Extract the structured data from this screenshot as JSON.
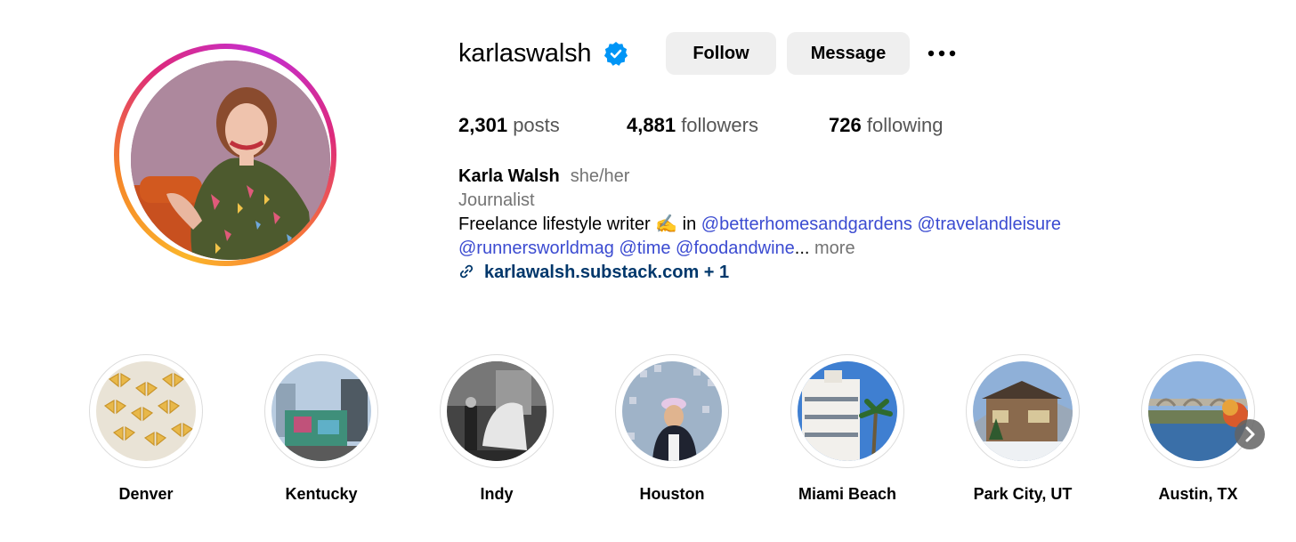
{
  "profile": {
    "username": "karlaswalsh",
    "verified": true,
    "follow_label": "Follow",
    "message_label": "Message",
    "more_icon": "more-horizontal-icon"
  },
  "stats": {
    "posts_count": "2,301",
    "posts_label": "posts",
    "followers_count": "4,881",
    "followers_label": "followers",
    "following_count": "726",
    "following_label": "following"
  },
  "bio": {
    "name": "Karla Walsh",
    "pronouns": "she/her",
    "category": "Journalist",
    "line1_text": "Freelance lifestyle writer ✍️ in",
    "mentions_line1": [
      "@betterhomesandgardens",
      "@travelandleisure"
    ],
    "mentions_line2": [
      "@runnersworldmag",
      "@time",
      "@foodandwine"
    ],
    "ellipsis": "...",
    "more_label": "more",
    "link_text": "karlawalsh.substack.com + 1"
  },
  "highlights": [
    {
      "label": "Denver"
    },
    {
      "label": "Kentucky"
    },
    {
      "label": "Indy"
    },
    {
      "label": "Houston"
    },
    {
      "label": "Miami Beach"
    },
    {
      "label": "Park City, UT"
    },
    {
      "label": "Austin, TX"
    }
  ],
  "colors": {
    "verified_badge": "#0095f6",
    "mention": "#3b4bd1",
    "link": "#00376b",
    "button_bg": "#efefef"
  }
}
